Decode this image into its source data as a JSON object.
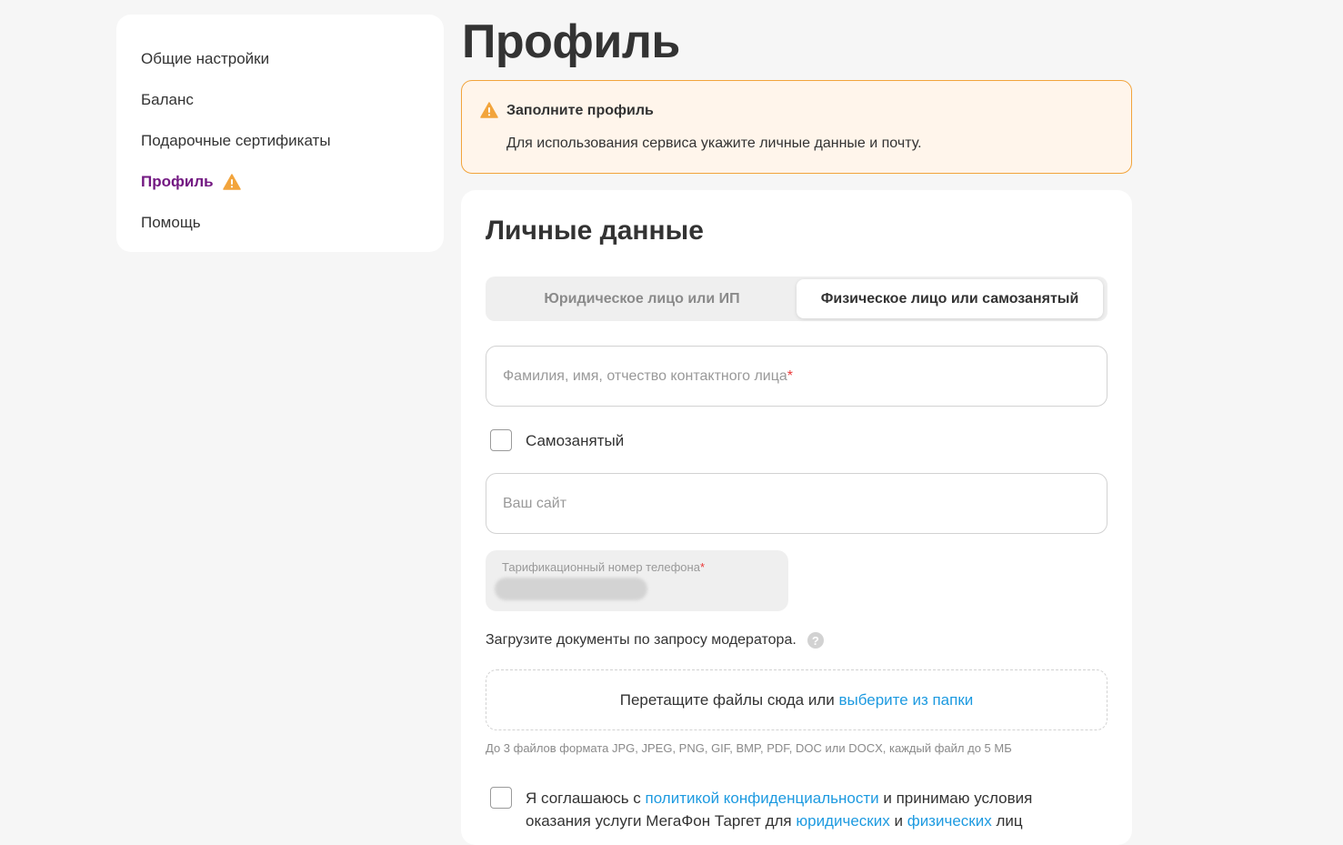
{
  "sidebar": {
    "items": [
      {
        "label": "Общие настройки"
      },
      {
        "label": "Баланс"
      },
      {
        "label": "Подарочные сертификаты"
      },
      {
        "label": "Профиль"
      },
      {
        "label": "Помощь"
      }
    ]
  },
  "page": {
    "title": "Профиль"
  },
  "alert": {
    "title": "Заполните профиль",
    "text": "Для использования сервиса укажите личные данные и почту."
  },
  "personal": {
    "title": "Личные данные",
    "tabs": {
      "legal": "Юридическое лицо или ИП",
      "individual": "Физическое лицо или самозанятый"
    },
    "name_field": {
      "placeholder": "Фамилия, имя, отчество контактного лица",
      "required_mark": "*",
      "value": ""
    },
    "self_employed": {
      "label": "Самозанятый",
      "checked": false
    },
    "site_field": {
      "placeholder": "Ваш сайт",
      "value": ""
    },
    "phone_field": {
      "label": "Тарификационный номер телефона",
      "required_mark": "*"
    },
    "upload": {
      "caption": "Загрузите документы по запросу модератора.",
      "help_glyph": "?",
      "drop_text": "Перетащите файлы сюда или",
      "drop_link": "выберите из папки",
      "hint": "До 3 файлов формата JPG, JPEG, PNG, GIF, BMP, PDF, DOC или DOCX, каждый файл до 5 МБ"
    },
    "agreement": {
      "text_1": "Я соглашаюсь с",
      "link_privacy": "политикой конфиденциальности",
      "text_2": "и принимаю условия оказания услуги МегаФон Таргет для",
      "link_legal": "юридических",
      "text_3": "и",
      "link_individual": "физических",
      "text_4": "лиц",
      "checked": false
    }
  },
  "colors": {
    "accent_purple": "#731982",
    "warning_orange": "#f2a43c",
    "link_blue": "#1d9ae0",
    "required_red": "#eb3a3a",
    "page_bg": "#f6f6f6"
  }
}
